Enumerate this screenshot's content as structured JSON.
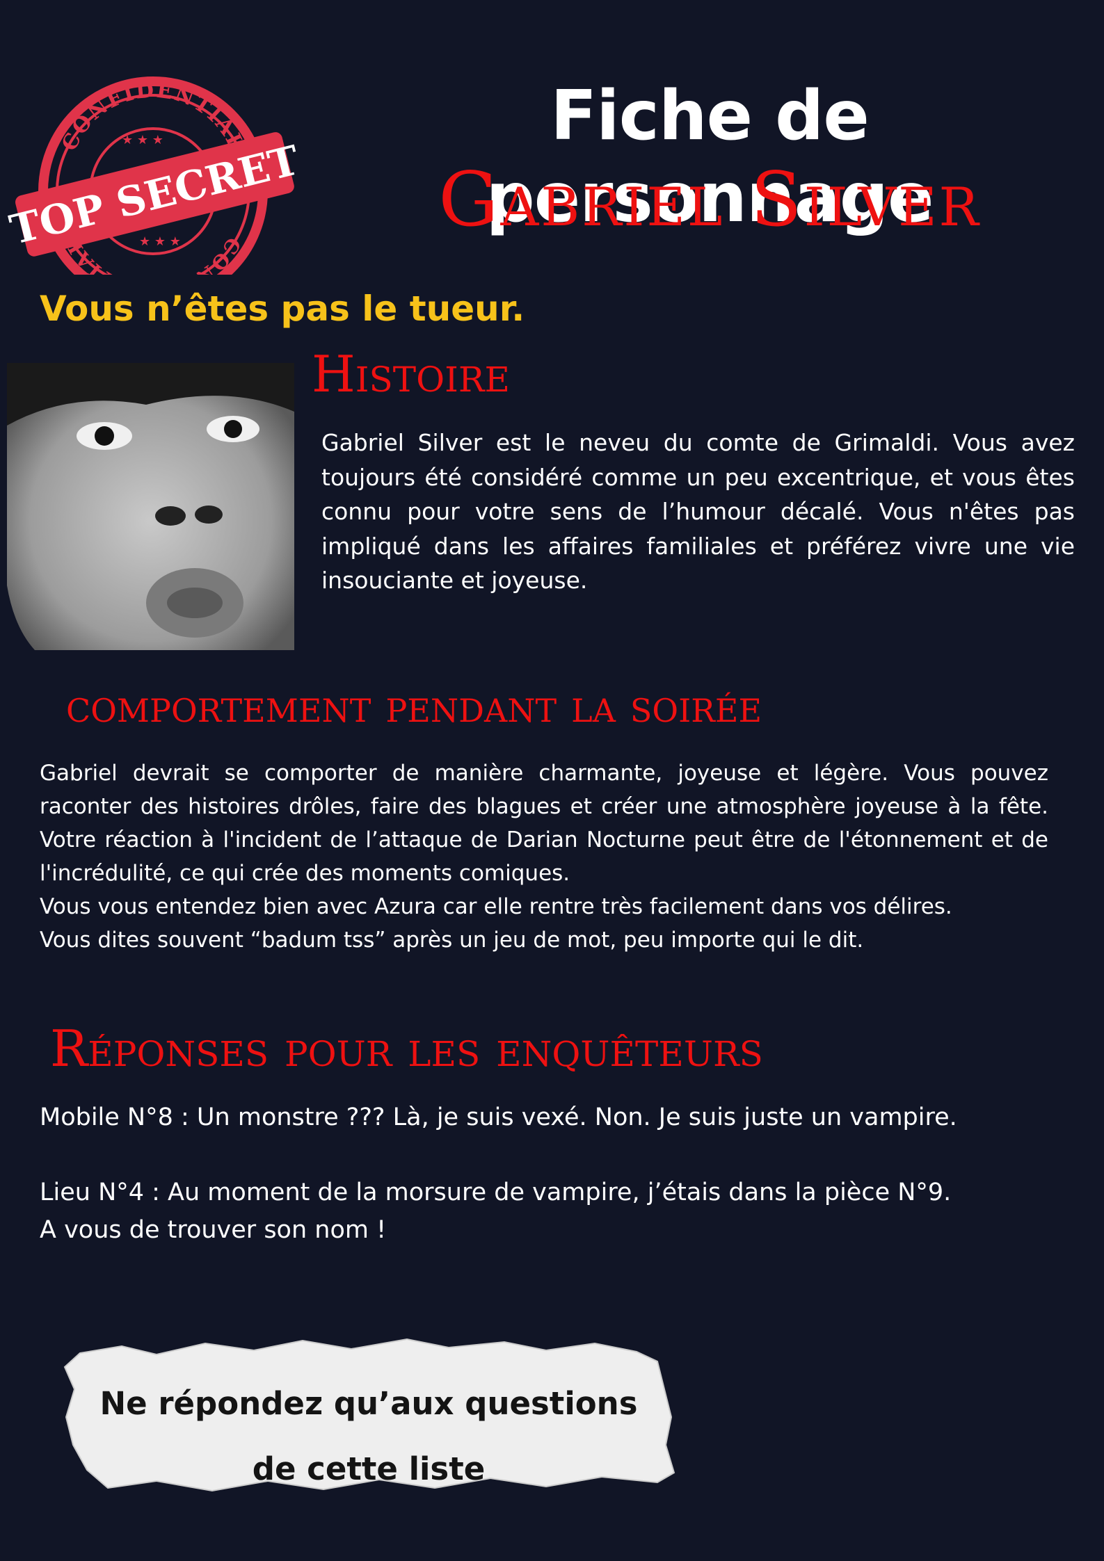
{
  "stamp": {
    "top_text": "CONFIDENTIAL",
    "bottom_text": "CONFIDENTIAL",
    "banner_text": "TOP SECRET",
    "color": "#e0344a"
  },
  "header": {
    "title": "Fiche de personnage",
    "character_name": "Gabriel Silver"
  },
  "status": "Vous n’êtes pas le tueur.",
  "histoire": {
    "heading": "Histoire",
    "text": "Gabriel Silver est le neveu du comte de Grimaldi. Vous avez toujours été considéré comme un peu excentrique, et vous êtes connu pour votre sens de l’humour décalé. Vous n'êtes pas impliqué dans les affaires familiales et préférez vivre une vie insouciante et joyeuse."
  },
  "comportement": {
    "heading": "comportement pendant la soirée",
    "paragraphs": [
      "Gabriel devrait se comporter de manière charmante, joyeuse et légère. Vous pouvez raconter des histoires drôles, faire des blagues et créer une atmosphère joyeuse à la fête. Votre réaction à l'incident de l’attaque de Darian Nocturne peut être de l'étonnement et de l'incrédulité, ce qui crée des moments comiques.",
      "Vous vous entendez bien avec Azura car elle rentre très facilement dans vos délires.",
      "Vous dites souvent “badum tss” après un jeu de mot, peu importe qui le dit."
    ]
  },
  "reponses": {
    "heading": "Réponses pour les enquêteurs",
    "mobile": "Mobile N°8 : Un monstre ??? Là, je suis vexé. Non. Je suis juste un vampire.",
    "lieu": "Lieu N°4 : Au moment de la morsure de vampire, j’étais dans la pièce N°9.",
    "lieu_hint": "A vous de trouver son nom !"
  },
  "note": {
    "line1": "Ne répondez qu’aux questions",
    "line2": "de cette liste"
  },
  "colors": {
    "background": "#111526",
    "accent_red": "#ee1111",
    "accent_yellow": "#f7c21a"
  }
}
